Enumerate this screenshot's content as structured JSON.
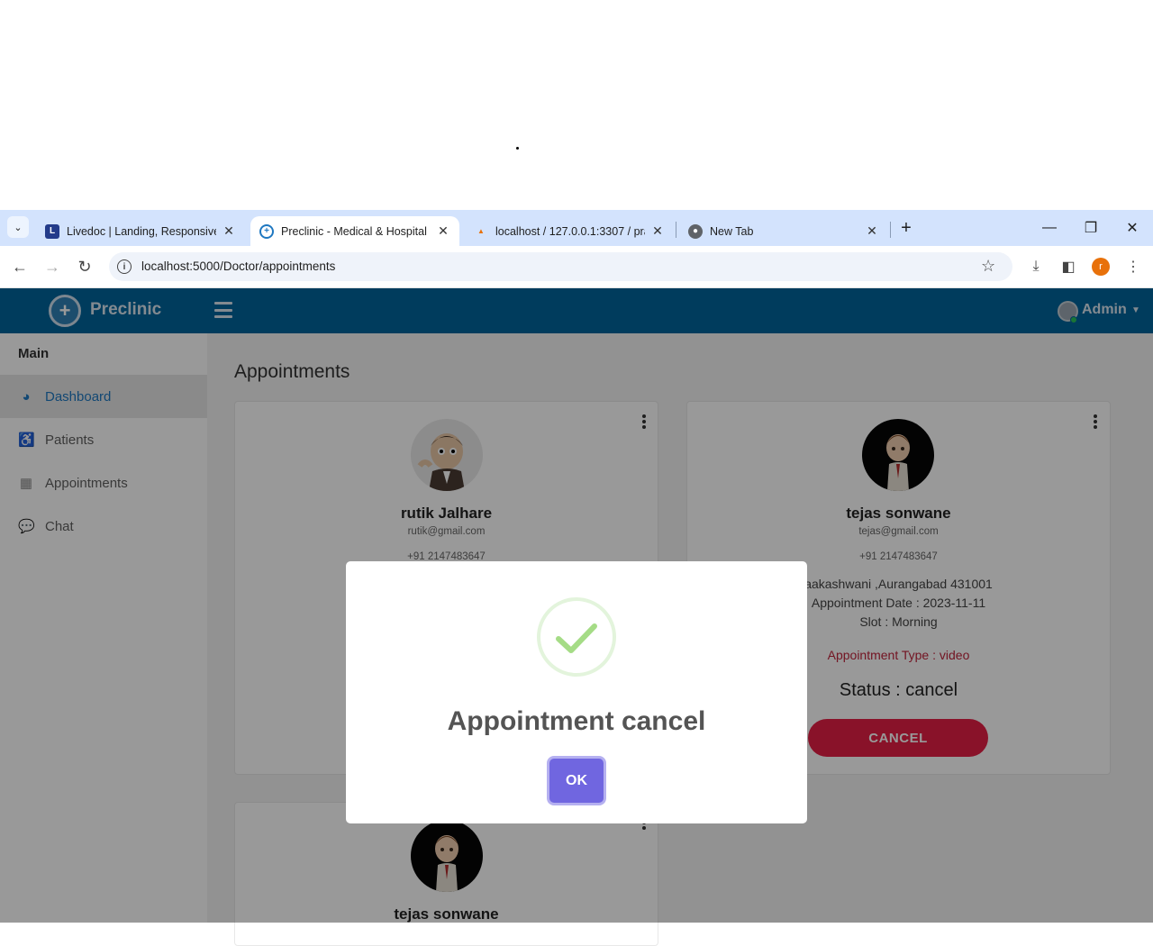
{
  "browser": {
    "tabs": [
      {
        "title": "Livedoc | Landing, Responsive",
        "favicon": "L",
        "active": false
      },
      {
        "title": "Preclinic - Medical & Hospital",
        "favicon": "+",
        "active": true
      },
      {
        "title": "localhost / 127.0.0.1:3307 / pra",
        "favicon": "pma",
        "active": false
      },
      {
        "title": "New Tab",
        "favicon": "chrome",
        "active": false
      }
    ],
    "url": "localhost:5000/Doctor/appointments",
    "profile_initial": "r"
  },
  "header": {
    "logo_text": "Preclinic",
    "user_label": "Admin"
  },
  "sidebar": {
    "section": "Main",
    "items": [
      {
        "label": "Dashboard",
        "icon": "dashboard-icon",
        "active": true
      },
      {
        "label": "Patients",
        "icon": "wheelchair-icon",
        "active": false
      },
      {
        "label": "Appointments",
        "icon": "calendar-icon",
        "active": false
      },
      {
        "label": "Chat",
        "icon": "chat-icon",
        "active": false
      }
    ]
  },
  "main": {
    "title": "Appointments",
    "cards": [
      {
        "name": "rutik Jalhare",
        "email": "rutik@gmail.com",
        "phone": "+91 2147483647"
      },
      {
        "name": "tejas sonwane",
        "email": "tejas@gmail.com",
        "phone": "+91 2147483647",
        "address": "aakashwani ,Aurangabad 431001",
        "date": "Appointment Date : 2023-11-11",
        "slot": "Slot : Morning",
        "type": "Appointment Type : video",
        "status": "Status : cancel",
        "action": "CANCEL"
      },
      {
        "name": "tejas sonwane"
      }
    ]
  },
  "modal": {
    "title": "Appointment cancel",
    "confirm_label": "OK",
    "icon": "success-check-icon"
  },
  "colors": {
    "header": "#00649c",
    "accent": "#1f78c1",
    "cancel": "#e51f45",
    "ok": "#7066e0"
  }
}
